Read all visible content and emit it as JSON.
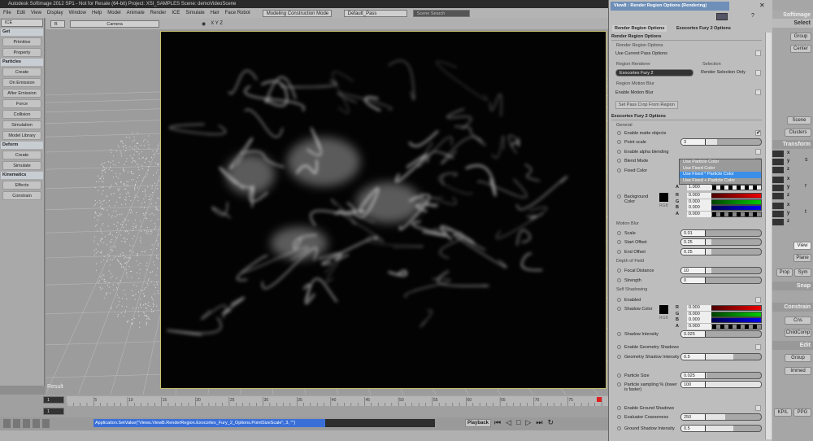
{
  "app": {
    "title": "Autodesk Softimage 2012 SP1 - Not for Resale (64-bit)    Project: XSI_SAMPLES    Scene: demoVideoScene"
  },
  "menu": [
    "File",
    "Edit",
    "View",
    "Display",
    "Window",
    "Help",
    "Model",
    "Animate",
    "Render",
    "ICE",
    "Simulate",
    "Hair",
    "Face Robot"
  ],
  "construction_mode": "Modeling Construction Mode",
  "pass": "Default_Pass",
  "search_placeholder": "Scene Search",
  "left_panel": {
    "module": "ICE",
    "items": [
      {
        "type": "header",
        "label": "Get"
      },
      {
        "type": "button",
        "label": "Primitive"
      },
      {
        "type": "button",
        "label": "Property"
      },
      {
        "type": "header",
        "label": "Particles"
      },
      {
        "type": "button",
        "label": "Create"
      },
      {
        "type": "button",
        "label": "On Emission"
      },
      {
        "type": "button",
        "label": "After Emission"
      },
      {
        "type": "button",
        "label": "Force"
      },
      {
        "type": "button",
        "label": "Collision"
      },
      {
        "type": "button",
        "label": "Simulation"
      },
      {
        "type": "button",
        "label": "Model Library"
      },
      {
        "type": "header",
        "label": "Deform"
      },
      {
        "type": "button",
        "label": "Create"
      },
      {
        "type": "button",
        "label": "Simulate"
      },
      {
        "type": "header",
        "label": "Kinematics"
      },
      {
        "type": "button",
        "label": "Effects"
      },
      {
        "type": "button",
        "label": "Constrain"
      }
    ]
  },
  "viewport": {
    "camera": "Camera",
    "axes": "X Y Z",
    "result_label": "Result"
  },
  "prop": {
    "title": "View8 : Render Region Options (Rendering)",
    "tabs": [
      "Render Region Options",
      "Exocortex Fury 2 Options"
    ],
    "sec1": "Render Region Options",
    "grp_rro": "Render Region Options",
    "use_current_pass": "Use Current Pass Options",
    "grp_renderer": "Region Renderer",
    "renderer": "Exocortex Fury 2",
    "grp_selection": "Selection",
    "render_selection_only": "Render Selection Only",
    "grp_motion": "Region Motion Blur",
    "enable_motion_blur": "Enable Motion Blur",
    "set_pass_crop": "Set Pass Crop From Region",
    "sec2": "Exocortex Fury 2 Options",
    "general": "General",
    "enable_matte": "Enable matte objects",
    "point_scale": {
      "label": "Point scale",
      "value": "3",
      "fill": 0.45
    },
    "enable_alpha": "Enable alpha blending",
    "blend_mode": "Blend Mode",
    "blend_options": [
      "Use Particle Color",
      "Use Fixed Color",
      "Use Fixed * Particle Color",
      "Use Fixed + Particle Color"
    ],
    "blend_selected": 2,
    "fixed_color": "Fixed Color",
    "fixed_a": "1.000",
    "background_color": "Background Color",
    "bg": {
      "r": "0.000",
      "g": "0.000",
      "b": "0.000",
      "a": "0.000"
    },
    "rgb": "RGB",
    "motion_blur": "Motion Blur",
    "scale": {
      "label": "Scale",
      "value": "0.01",
      "fill": 0.3
    },
    "start_offset": {
      "label": "Start Offset",
      "value": "0.25",
      "fill": 0.38
    },
    "end_offset": {
      "label": "End Offset",
      "value": "0.25",
      "fill": 0.38
    },
    "dof": "Depth of Field",
    "focal_distance": {
      "label": "Focal Distance",
      "value": "10",
      "fill": 0.38
    },
    "strength": {
      "label": "Strength",
      "value": "0",
      "fill": 0.3
    },
    "self_shadowing": "Self Shadowing",
    "enabled": "Enabled",
    "shadow_color": "Shadow Color",
    "sc": {
      "r": "0.000",
      "g": "0.000",
      "b": "0.000",
      "a": "0.000"
    },
    "shadow_intensity": {
      "label": "Shadow Intensity",
      "value": "0.025",
      "fill": 0.3
    },
    "enable_geo_shadows": "Enable Geometry Shadows",
    "geo_shadow_intensity": {
      "label": "Geometry Shadow Intensity",
      "value": "0.5",
      "fill": 0.65
    },
    "particle_size": {
      "label": "Particle Size",
      "value": "0.025",
      "fill": 0.32
    },
    "particle_sampling": {
      "label": "Particle sampling % (lower is faster)",
      "value": "100",
      "fill": 1.0
    },
    "enable_ground_shadows": "Enable Ground Shadows",
    "evaluator_coarseness": {
      "label": "Evaluator Coarseness",
      "value": "250",
      "fill": 0.55
    },
    "ground_shadow_intensity": {
      "label": "Ground Shadow Intensity",
      "value": "0.5",
      "fill": 0.65
    }
  },
  "right_toolbar": {
    "brand": "Softimage",
    "select": "Select",
    "group": "Group",
    "center": "Center",
    "scene": "Scene",
    "clusters": "Clusters",
    "transform": "Transform",
    "view": "View",
    "plane": "Plane",
    "prop": "Prop",
    "sym": "Sym",
    "snap": "Snap",
    "constrain": "Constrain",
    "cns": "Cns",
    "childcomp": "ChildComp",
    "edit": "Edit",
    "group2": "Group",
    "immed": "Immed",
    "kpl": "KP/L",
    "ppg": "PPG",
    "xyz": [
      "x",
      "y",
      "z"
    ],
    "srt": [
      "s",
      "r",
      "t"
    ]
  },
  "timeline": {
    "start": "1",
    "current": "1",
    "ticks": [
      "5",
      "10",
      "15",
      "20",
      "25",
      "30",
      "35",
      "40",
      "45",
      "50",
      "55",
      "60",
      "65",
      "70",
      "75"
    ]
  },
  "command_line": "Application.SetValue(\"Views.ViewB.RenderRegion.Exocortex_Fury_2_Options.PointSizeScale\", 3, \"\")",
  "playback": "Playback"
}
